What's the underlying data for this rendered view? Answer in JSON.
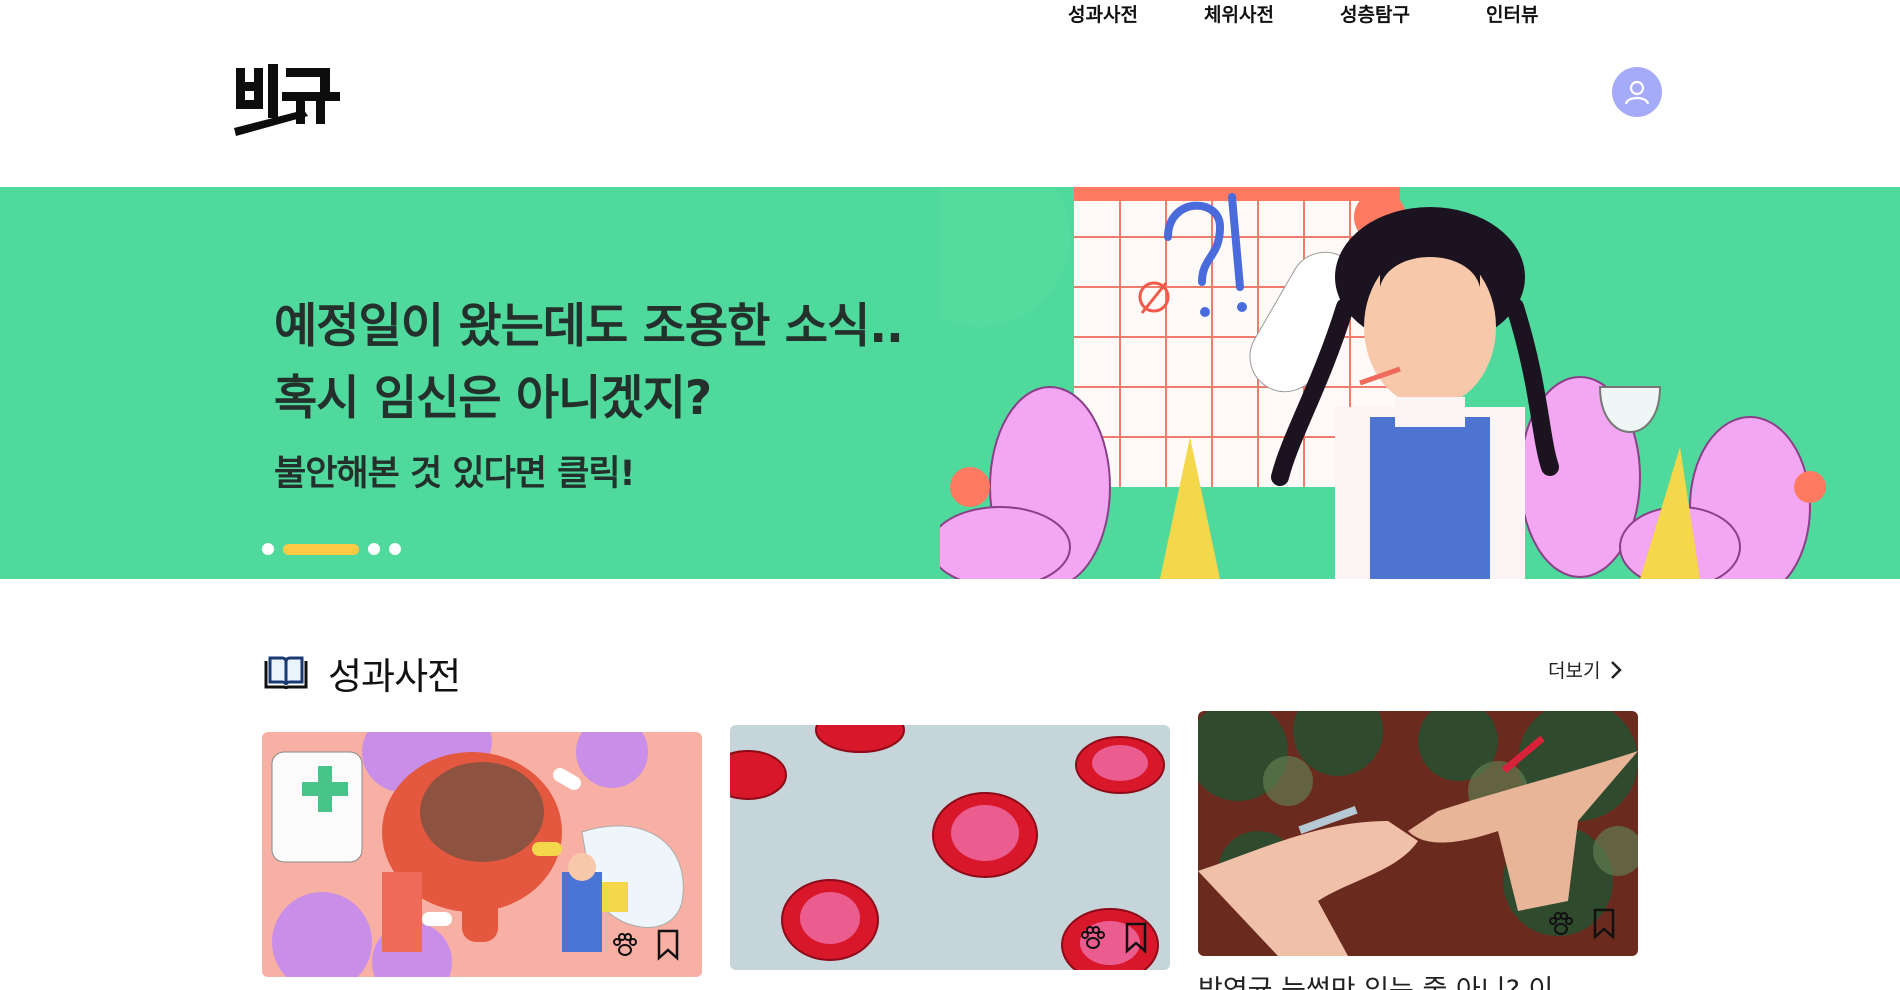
{
  "header": {
    "logo_text": "비뉴",
    "nav": [
      "성과사전",
      "체위사전",
      "성층탐구",
      "인터뷰"
    ]
  },
  "banner": {
    "line1": "예정일이 왔는데도 조용한 소식..",
    "line2": "혹시 임신은 아니겠지?",
    "cta": "불안해본 것 있다면 클릭!",
    "slide_count": 4,
    "active_slide": 2,
    "background": "#4fd99c",
    "active_dot_color": "#ffcb45"
  },
  "section": {
    "title": "성과사전",
    "more_label": "더보기",
    "icon": "book-icon"
  },
  "cards": [
    {
      "image": "illustration-bladder",
      "icons": [
        "paw-icon",
        "bookmark-icon"
      ]
    },
    {
      "image": "photo-condoms",
      "icons": [
        "paw-icon",
        "bookmark-icon"
      ]
    },
    {
      "image": "photo-pinky-promise",
      "icons": [
        "paw-icon",
        "bookmark-icon"
      ],
      "title": "방역균 능썼만 있는 줄 아니? 이"
    }
  ]
}
